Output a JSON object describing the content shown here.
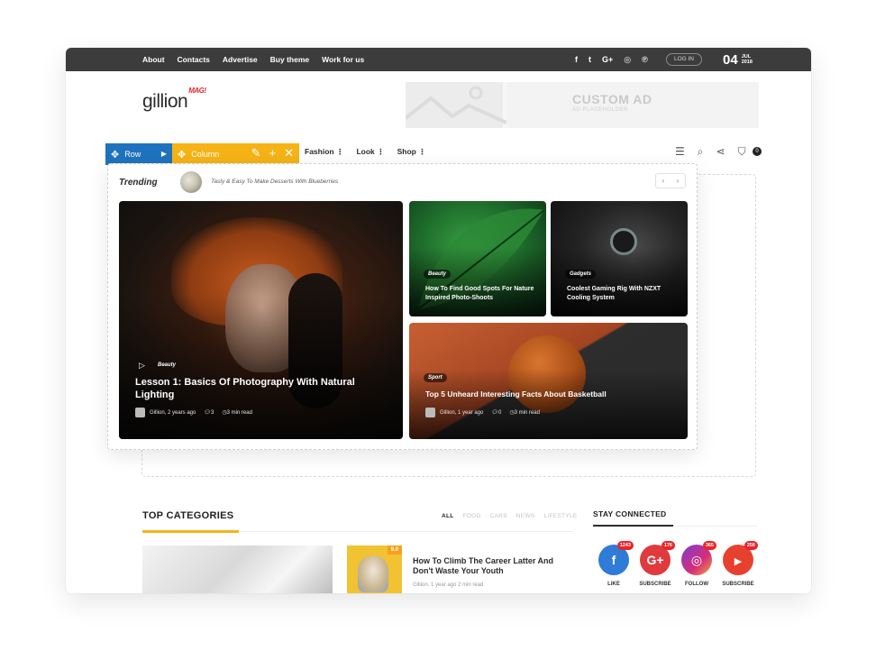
{
  "topbar": {
    "nav": [
      "About",
      "Contacts",
      "Advertise",
      "Buy theme",
      "Work for us"
    ],
    "socials": [
      "f",
      "t",
      "G+",
      "◎",
      "℗"
    ],
    "login": "LOG IN",
    "date_day": "04",
    "date_month": "JUL",
    "date_year": "2018"
  },
  "header": {
    "logo": "gillion",
    "logo_badge": "MAG!",
    "ad_title": "CUSTOM AD",
    "ad_sub": "AD PLACEHOLDER"
  },
  "builder": {
    "row_label": "Row",
    "column_label": "Column"
  },
  "menu": [
    "Fashion ⋮",
    "Look ⋮",
    "Shop ⋮"
  ],
  "cart_count": "0",
  "trending": {
    "label": "Trending",
    "text": "Tasty & Easy To Make Desserts With Blueberries"
  },
  "cards": {
    "big": {
      "category": "Beauty",
      "title": "Lesson 1: Basics Of Photography With Natural Lighting",
      "author": "Gillion, 2 years ago",
      "comments": "3",
      "read": "3 min read"
    },
    "small1": {
      "category": "Beauty",
      "title": "How To Find Good Spots For Nature Inspired Photo-Shoots"
    },
    "small2": {
      "category": "Gadgets",
      "title": "Coolest Gaming Rig With NZXT Cooling System"
    },
    "wide": {
      "category": "Sport",
      "title": "Top 5 Unheard Interesting Facts About Basketball",
      "author": "Gillion, 1 year ago",
      "comments": "0",
      "read": "3 min read"
    }
  },
  "top_categories": {
    "title": "TOP CATEGORIES",
    "filters": [
      "ALL",
      "FOOD",
      "CARS",
      "NEWS",
      "LIFESTYLE"
    ],
    "score": "9.0",
    "post_title": "How To Climb The Career Latter And Don't Waste Your Youth",
    "post_meta": "Gillion, 1 year ago    2 min read"
  },
  "stay_connected": {
    "title": "STAY CONNECTED",
    "items": [
      {
        "icon": "f",
        "count": "1243",
        "label": "LIKE",
        "color": "#2f7bd6"
      },
      {
        "icon": "G+",
        "count": "176",
        "label": "SUBSCRIBE",
        "color": "#e0393e"
      },
      {
        "icon": "◎",
        "count": "365",
        "label": "FOLLOW",
        "color": "#b5339a"
      },
      {
        "icon": "▶",
        "count": "256",
        "label": "SUBSCRIBE",
        "color": "#e8402f"
      }
    ]
  }
}
